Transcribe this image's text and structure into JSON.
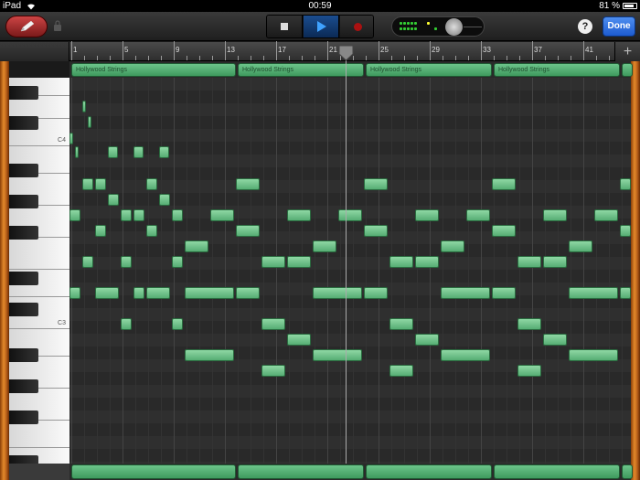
{
  "status_bar": {
    "device": "iPad",
    "time": "00:59",
    "battery": "81 %"
  },
  "toolbar": {
    "help_label": "?",
    "done_label": "Done",
    "add_label": "+"
  },
  "ruler": {
    "bars": [
      "1",
      "5",
      "9",
      "13",
      "17",
      "21",
      "25",
      "29",
      "33",
      "37",
      "41"
    ]
  },
  "regions": [
    "Hollywood Strings",
    "Hollywood Strings",
    "Hollywood Strings",
    "Hollywood Strings"
  ],
  "keyboard": {
    "labels": [
      "C4",
      "C3"
    ]
  },
  "colors": {
    "note": "#6cc48a",
    "edit_button": "#b33",
    "play_active": "#1b4d8f"
  }
}
